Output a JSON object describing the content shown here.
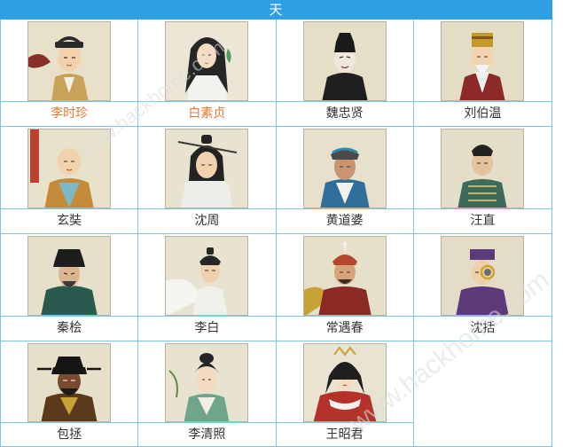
{
  "header": {
    "title": "天"
  },
  "colors": {
    "header_bg": "#2e9fe3",
    "border": "#7fc4ea",
    "highlight_name": "#e8762e",
    "normal_name": "#333333"
  },
  "watermark": "www.hackhome.com",
  "rows": [
    [
      {
        "name": "李时珍",
        "highlight": true,
        "icon": "portrait-li-shizhen"
      },
      {
        "name": "白素贞",
        "highlight": true,
        "icon": "portrait-bai-suzhen"
      },
      {
        "name": "魏忠贤",
        "highlight": false,
        "icon": "portrait-wei-zhongxian"
      },
      {
        "name": "刘伯温",
        "highlight": false,
        "icon": "portrait-liu-bowen"
      }
    ],
    [
      {
        "name": "玄奘",
        "highlight": false,
        "icon": "portrait-xuanzang"
      },
      {
        "name": "沈周",
        "highlight": false,
        "icon": "portrait-shen-zhou"
      },
      {
        "name": "黄道婆",
        "highlight": false,
        "icon": "portrait-huang-daopo"
      },
      {
        "name": "汪直",
        "highlight": false,
        "icon": "portrait-wang-zhi"
      }
    ],
    [
      {
        "name": "秦桧",
        "highlight": false,
        "icon": "portrait-qin-hui"
      },
      {
        "name": "李白",
        "highlight": false,
        "icon": "portrait-li-bai"
      },
      {
        "name": "常遇春",
        "highlight": false,
        "icon": "portrait-chang-yuchun"
      },
      {
        "name": "沈括",
        "highlight": false,
        "icon": "portrait-shen-kuo"
      }
    ],
    [
      {
        "name": "包拯",
        "highlight": false,
        "icon": "portrait-bao-zheng"
      },
      {
        "name": "李清照",
        "highlight": false,
        "icon": "portrait-li-qingzhao"
      },
      {
        "name": "王昭君",
        "highlight": false,
        "icon": "portrait-wang-zhaojun"
      }
    ]
  ]
}
